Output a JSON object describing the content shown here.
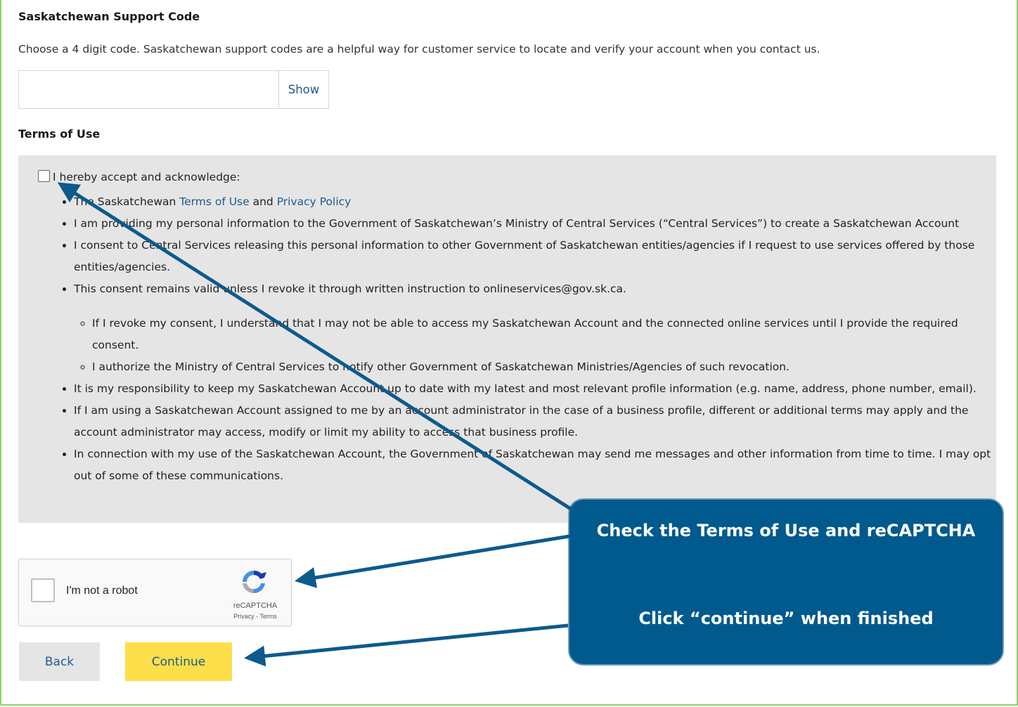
{
  "support_code": {
    "heading": "Saskatchewan Support Code",
    "description": "Choose a 4 digit code. Saskatchewan support codes are a helpful way for customer service to locate and verify your account when you contact us.",
    "input_value": "",
    "show_label": "Show"
  },
  "terms": {
    "heading": "Terms of Use",
    "checkbox_checked": false,
    "lead": "I hereby accept and acknowledge:",
    "item1_prefix": "The Saskatchewan ",
    "item1_link1": "Terms of Use",
    "item1_mid": " and ",
    "item1_link2": "Privacy Policy",
    "item2": "I am providing my personal information to the Government of Saskatchewan’s Ministry of Central Services (“Central Services”) to create a Saskatchewan Account",
    "item3": "I consent to Central Services releasing this personal information to other Government of Saskatchewan entities/agencies if I request to use services offered by those entities/agencies.",
    "item4": "This consent remains valid unless I revoke it through written instruction to onlineservices@gov.sk.ca.",
    "sub1": "If I revoke my consent, I understand that I may not be able to access my Saskatchewan Account and the connected online services until I provide the required consent.",
    "sub2": "I authorize the Ministry of Central Services to notify other Government of Saskatchewan Ministries/Agencies of such revocation.",
    "item5": "It is my responsibility to keep my Saskatchewan Account up to date with my latest and most relevant profile information (e.g. name, address, phone number, email).",
    "item6": "If I am using a Saskatchewan Account assigned to me by an account administrator in the case of a business profile, different or additional terms may apply and the account administrator may access, modify or limit my ability to access that business profile.",
    "item7": "In connection with my use of the Saskatchewan Account, the Government of Saskatchewan may send me messages and other information from time to time. I may opt out of some of these communications."
  },
  "recaptcha": {
    "label": "I'm not a robot",
    "brand": "reCAPTCHA",
    "links": "Privacy - Terms",
    "icon": "recaptcha-logo-icon"
  },
  "buttons": {
    "back": "Back",
    "continue": "Continue"
  },
  "callout": {
    "line1": "Check the Terms of Use and reCAPTCHA",
    "line2": "Click “continue” when finished"
  },
  "colors": {
    "frame_border": "#8ed36a",
    "link": "#1f5a91",
    "terms_bg": "#e5e5e5",
    "continue_bg": "#fddf4a",
    "callout_bg": "#005a8e",
    "arrow": "#0d5a8c"
  }
}
